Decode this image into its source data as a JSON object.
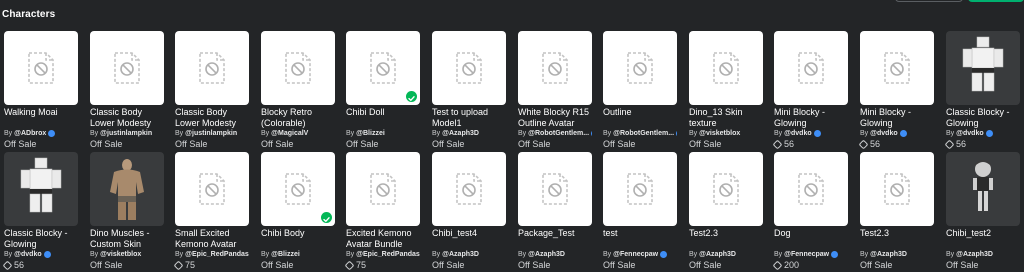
{
  "section": {
    "title": "Characters"
  },
  "items_row1": [
    {
      "name": "Walking Moai",
      "creator": "@ADbrox",
      "verified": true,
      "price": "Off Sale",
      "robux": false,
      "thumb": "placeholder",
      "owned": false
    },
    {
      "name": "Classic Body Lower Modesty",
      "creator": "@justinlampkin",
      "verified": false,
      "price": "Off Sale",
      "robux": false,
      "thumb": "placeholder",
      "owned": false
    },
    {
      "name": "Classic Body Lower Modesty",
      "creator": "@justinlampkin",
      "verified": false,
      "price": "Off Sale",
      "robux": false,
      "thumb": "placeholder",
      "owned": false
    },
    {
      "name": "Blocky Retro (Colorable)",
      "creator": "@MagicalV",
      "verified": false,
      "price": "Off Sale",
      "robux": false,
      "thumb": "placeholder",
      "owned": false
    },
    {
      "name": "Chibi Doll",
      "creator": "@Blizzei",
      "verified": false,
      "price": "Off Sale",
      "robux": false,
      "thumb": "placeholder",
      "owned": true
    },
    {
      "name": "Test to upload Model1",
      "creator": "@Azaph3D",
      "verified": false,
      "price": "Off Sale",
      "robux": false,
      "thumb": "placeholder",
      "owned": false
    },
    {
      "name": "White Blocky R15 Outline Avatar",
      "creator": "@RobotGentlem...",
      "verified": true,
      "price": "Off Sale",
      "robux": false,
      "thumb": "placeholder",
      "owned": false
    },
    {
      "name": "Outline",
      "creator": "@RobotGentlem...",
      "verified": true,
      "price": "Off Sale",
      "robux": false,
      "thumb": "placeholder",
      "owned": false
    },
    {
      "name": "Dino_13 Skin texture",
      "creator": "@visketblox",
      "verified": false,
      "price": "Off Sale",
      "robux": false,
      "thumb": "placeholder",
      "owned": false
    },
    {
      "name": "Mini Blocky - Glowing",
      "creator": "@dvdko",
      "verified": true,
      "price": "56",
      "robux": true,
      "thumb": "placeholder",
      "owned": false
    },
    {
      "name": "Mini Blocky - Glowing",
      "creator": "@dvdko",
      "verified": true,
      "price": "56",
      "robux": true,
      "thumb": "placeholder",
      "owned": false
    },
    {
      "name": "Classic Blocky - Glowing",
      "creator": "@dvdko",
      "verified": true,
      "price": "56",
      "robux": true,
      "thumb": "blocky",
      "owned": false
    }
  ],
  "items_row2": [
    {
      "name": "Classic Blocky - Glowing",
      "creator": "@dvdko",
      "verified": true,
      "price": "56",
      "robux": true,
      "thumb": "blocky",
      "owned": false
    },
    {
      "name": "Dino Muscles - Custom Skin",
      "creator": "@visketblox",
      "verified": false,
      "price": "Off Sale",
      "robux": false,
      "thumb": "muscles",
      "owned": false
    },
    {
      "name": "Small Excited Kemono Avatar",
      "creator": "@Epic_RedPandas",
      "verified": false,
      "price": "75",
      "robux": true,
      "thumb": "placeholder",
      "owned": false
    },
    {
      "name": "Chibi Body",
      "creator": "@Blizzei",
      "verified": false,
      "price": "Off Sale",
      "robux": false,
      "thumb": "placeholder",
      "owned": true
    },
    {
      "name": "Excited Kemono Avatar Bundle",
      "creator": "@Epic_RedPandas",
      "verified": false,
      "price": "75",
      "robux": true,
      "thumb": "placeholder",
      "owned": false
    },
    {
      "name": "Chibi_test4",
      "creator": "@Azaph3D",
      "verified": false,
      "price": "Off Sale",
      "robux": false,
      "thumb": "placeholder",
      "owned": false
    },
    {
      "name": "Package_Test",
      "creator": "@Azaph3D",
      "verified": false,
      "price": "Off Sale",
      "robux": false,
      "thumb": "placeholder",
      "owned": false
    },
    {
      "name": "test",
      "creator": "@Fennecpaw",
      "verified": true,
      "price": "Off Sale",
      "robux": false,
      "thumb": "placeholder",
      "owned": false
    },
    {
      "name": "Test2.3",
      "creator": "@Azaph3D",
      "verified": false,
      "price": "Off Sale",
      "robux": false,
      "thumb": "placeholder",
      "owned": false
    },
    {
      "name": "Dog",
      "creator": "@Fennecpaw",
      "verified": true,
      "price": "200",
      "robux": true,
      "thumb": "placeholder",
      "owned": false
    },
    {
      "name": "Test2.3",
      "creator": "@Azaph3D",
      "verified": false,
      "price": "Off Sale",
      "robux": false,
      "thumb": "placeholder",
      "owned": false
    },
    {
      "name": "Chibi_test2",
      "creator": "@Azaph3D",
      "verified": false,
      "price": "Off Sale",
      "robux": false,
      "thumb": "chibi",
      "owned": false
    }
  ]
}
